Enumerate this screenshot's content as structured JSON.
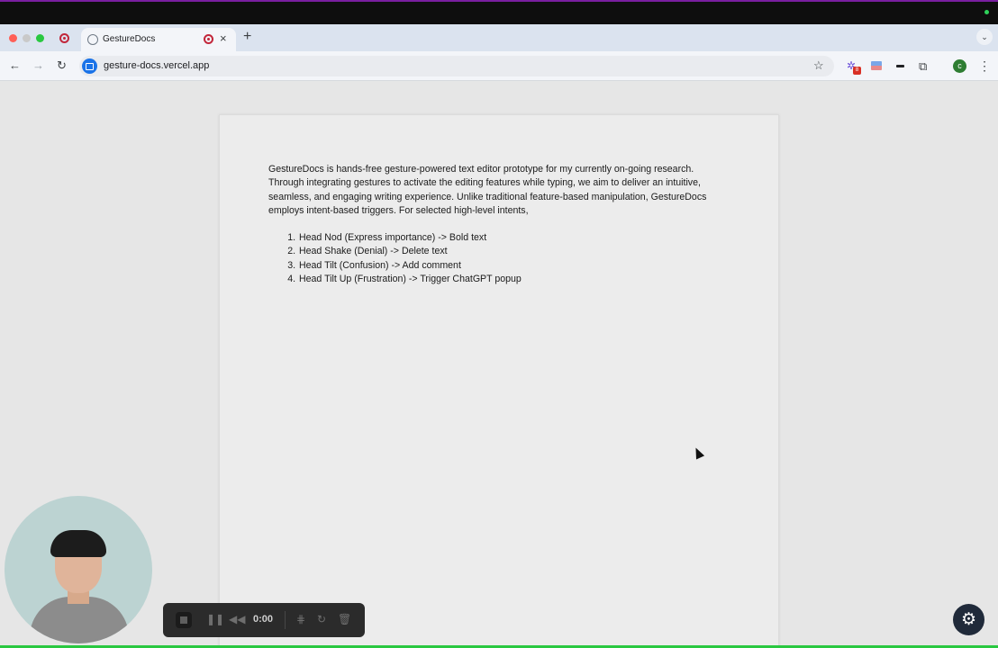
{
  "browser": {
    "tab": {
      "title": "GestureDocs",
      "close_glyph": "×"
    },
    "new_tab_glyph": "+",
    "tab_menu_glyph": "⌄",
    "address_bar": {
      "url": "gesture-docs.vercel.app"
    },
    "nav": {
      "back_glyph": "←",
      "forward_glyph": "→",
      "reload_glyph": "↻",
      "star_glyph": "☆",
      "puzzle_glyph": "⧉",
      "menu_glyph": "⋮"
    },
    "extensions": {
      "badge_count": "8"
    },
    "profile_initial": "c"
  },
  "document": {
    "intro": "GestureDocs is hands-free gesture-powered text editor prototype for my currently on-going research. Through integrating gestures to activate the editing features while typing, we aim to deliver an intuitive, seamless, and engaging writing experience. Unlike traditional feature-based manipulation, GestureDocs employs intent-based triggers. For selected high-level intents,",
    "items": [
      "Head Nod (Express importance) -> Bold text",
      "Head Shake (Denial) -> Delete text",
      "Head Tilt (Confusion) -> Add comment",
      "Head Tilt Up (Frustration) -> Trigger ChatGPT popup"
    ]
  },
  "recorder": {
    "time": "0:00",
    "pause_glyph": "❚❚",
    "rewind_glyph": "◀◀",
    "grid_glyph": "⋕",
    "restart_glyph": "↻",
    "trash_glyph": "🗑"
  },
  "settings_glyph": "⚙",
  "colors": {
    "accent_record": "#c2263a",
    "recording_indicator": "#2ed15a",
    "profile": "#2e7d32",
    "settings_fab": "#202a3a"
  }
}
